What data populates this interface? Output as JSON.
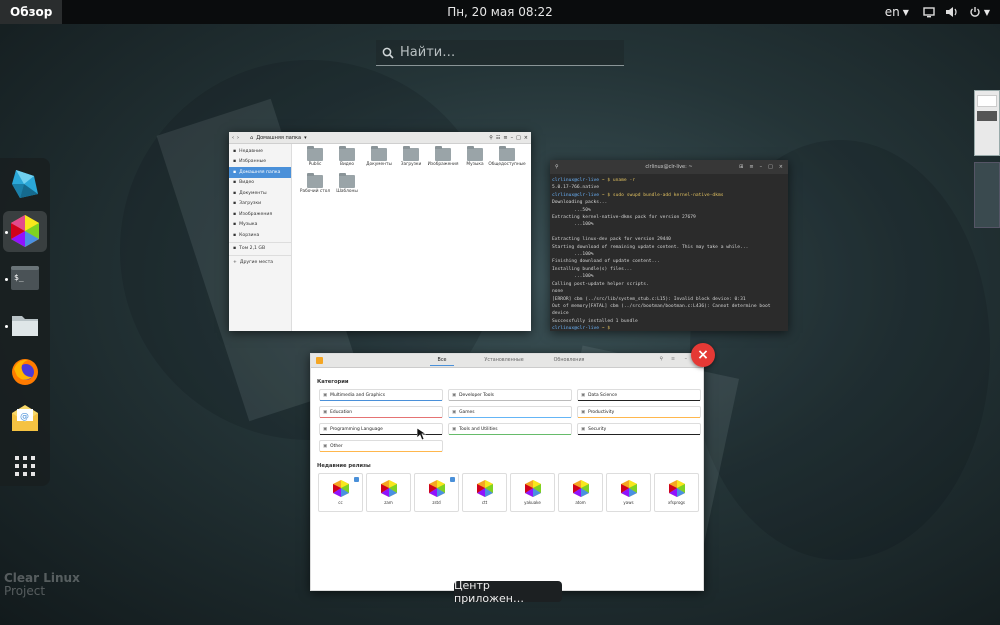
{
  "topbar": {
    "activities": "Обзор",
    "clock": "Пн, 20 мая  08:22",
    "lang": "en"
  },
  "search": {
    "placeholder": "Найти…"
  },
  "dash": {
    "icons": [
      "clear-linux-icon",
      "software-center-icon",
      "terminal-icon",
      "files-icon",
      "firefox-icon",
      "mail-icon",
      "app-grid-icon"
    ]
  },
  "files": {
    "path": "Домашняя папка",
    "sidebar": [
      "Недавние",
      "Избранные",
      "Домашняя папка",
      "Видео",
      "Документы",
      "Загрузки",
      "Изображения",
      "Музыка",
      "Корзина",
      "Том 2,1 GB",
      "Другие места"
    ],
    "folders": [
      "Public",
      "Видео",
      "Документы",
      "Загрузки",
      "Изображения",
      "Музыка",
      "Общедоступные",
      "Рабочий стол",
      "Шаблоны"
    ]
  },
  "terminal": {
    "title": "clrlinux@clr-live: ~",
    "lines": [
      {
        "prompt": "clrlinux@clr-live",
        "cmd": " ~ $ uname -r"
      },
      {
        "text": "5.0.17-766.native"
      },
      {
        "prompt": "clrlinux@clr-live",
        "cmd": " ~ $ sudo swupd bundle-add kernel-native-dkms"
      },
      {
        "text": "Downloading packs..."
      },
      {
        "text": "        ...50%"
      },
      {
        "text": "Extracting kernel-native-dkms pack for version 27679"
      },
      {
        "text": "        ...100%"
      },
      {
        "text": ""
      },
      {
        "text": "Extracting linux-dev pack for version 29440"
      },
      {
        "text": "Starting download of remaining update content. This may take a while..."
      },
      {
        "text": "        ...100%"
      },
      {
        "text": "Finishing download of update content..."
      },
      {
        "text": "Installing bundle(s) files..."
      },
      {
        "text": "        ...100%"
      },
      {
        "text": "Calling post-update helper scripts."
      },
      {
        "text": "none"
      },
      {
        "text": "[ERROR] cbm (../src/lib/system_stub.c:L15): Invalid block device: 0:31"
      },
      {
        "text": "Out of memory[FATAL] cbm (../src/bootman/bootman.c:L436): Cannot determine boot"
      },
      {
        "text": "device"
      },
      {
        "text": "Successfully installed 1 bundle"
      },
      {
        "prompt": "clrlinux@clr-live",
        "cmd": " ~ $ "
      }
    ]
  },
  "software": {
    "tabs": [
      "Все",
      "Установленные",
      "Обновления"
    ],
    "categories_title": "Категории",
    "categories": [
      {
        "label": "Multimedia and Graphics",
        "color": "#4a90d9"
      },
      {
        "label": "Developer Tools",
        "color": "#bbbbbb"
      },
      {
        "label": "Data Science",
        "color": "#222222"
      },
      {
        "label": "Education",
        "color": "#e57373"
      },
      {
        "label": "Games",
        "color": "#64b5f6"
      },
      {
        "label": "Productivity",
        "color": "#ffb74d"
      },
      {
        "label": "Programming Language",
        "color": "#222222"
      },
      {
        "label": "Tools and Utilities",
        "color": "#66bb6a"
      },
      {
        "label": "Security",
        "color": "#222222"
      },
      {
        "label": "Other",
        "color": "#ffb74d"
      }
    ],
    "recent_title": "Недавние релизы",
    "apps": [
      "cc",
      "zam",
      "zstd",
      "ctt",
      "yakuake",
      "atom",
      "yaws",
      "xfsprogs"
    ]
  },
  "tooltip": "Центр приложен…",
  "watermark": {
    "line1": "Clear Linux",
    "line2": "Project"
  }
}
